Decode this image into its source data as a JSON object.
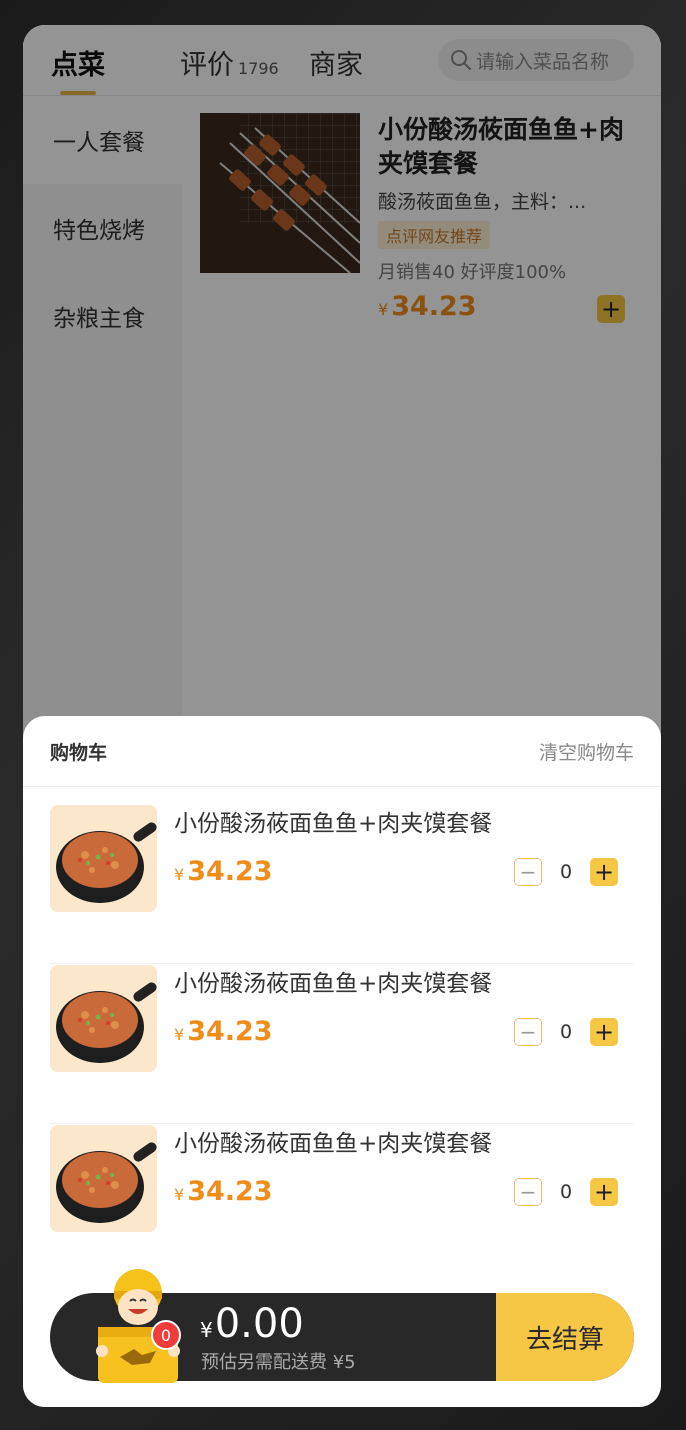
{
  "tabs": [
    {
      "label": "点菜"
    },
    {
      "label": "评价",
      "count": "1796"
    },
    {
      "label": "商家"
    }
  ],
  "search": {
    "placeholder": "请输入菜品名称"
  },
  "sidebar": {
    "items": [
      {
        "label": "一人套餐"
      },
      {
        "label": "特色烧烤"
      },
      {
        "label": "杂粮主食"
      }
    ]
  },
  "product": {
    "title": "小份酸汤莜面鱼鱼+肉夹馍套餐",
    "desc": "酸汤莜面鱼鱼，主料：...",
    "tag": "点评网友推荐",
    "sales": "月销售40 好评度100%",
    "currency": "¥",
    "price": "34.23",
    "add_label": "+"
  },
  "cart": {
    "title": "购物车",
    "clear_label": "清空购物车",
    "items": [
      {
        "name": "小份酸汤莜面鱼鱼+肉夹馍套餐",
        "currency": "¥",
        "price": "34.23",
        "minus": "−",
        "qty": "0",
        "plus": "+"
      },
      {
        "name": "小份酸汤莜面鱼鱼+肉夹馍套餐",
        "currency": "¥",
        "price": "34.23",
        "minus": "−",
        "qty": "0",
        "plus": "+"
      },
      {
        "name": "小份酸汤莜面鱼鱼+肉夹馍套餐",
        "currency": "¥",
        "price": "34.23",
        "minus": "−",
        "qty": "0",
        "plus": "+"
      }
    ]
  },
  "bottom_bar": {
    "badge": "0",
    "currency": "¥",
    "total": "0.00",
    "fee_note": "预估另需配送费 ¥5",
    "checkout_label": "去结算"
  },
  "colors": {
    "accent": "#f5c744",
    "price": "#f08d1a",
    "badge": "#f23c3c",
    "dark_bar": "#282828"
  }
}
